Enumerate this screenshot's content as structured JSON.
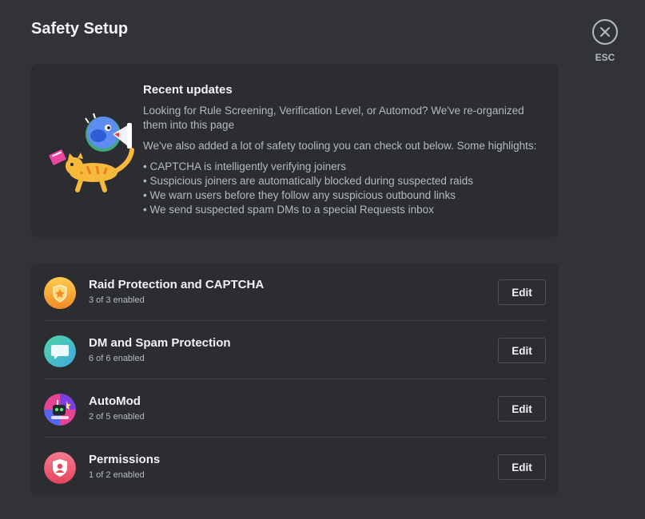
{
  "header": {
    "title": "Safety Setup",
    "close_label": "ESC"
  },
  "updates": {
    "title": "Recent updates",
    "para1": "Looking for Rule Screening, Verification Level, or Automod? We've re-organized them into this page",
    "para2": "We've also added a lot of safety tooling you can check out below. Some highlights:",
    "highlights": [
      "CAPTCHA is intelligently verifying joiners",
      "Suspicious joiners are automatically blocked during suspected raids",
      "We warn users before they follow any suspicious outbound links",
      "We send suspected spam DMs to a special Requests inbox"
    ]
  },
  "settings": {
    "edit_label": "Edit",
    "items": [
      {
        "title": "Raid Protection and CAPTCHA",
        "status": "3 of 3 enabled",
        "icon": "shield-star-icon",
        "color": "#f0a530"
      },
      {
        "title": "DM and Spam Protection",
        "status": "6 of 6 enabled",
        "icon": "chat-bubble-icon",
        "color": "#43c6a8"
      },
      {
        "title": "AutoMod",
        "status": "2 of 5 enabled",
        "icon": "automod-robot-icon",
        "color": "#8f4ee6"
      },
      {
        "title": "Permissions",
        "status": "1 of 2 enabled",
        "icon": "user-shield-icon",
        "color": "#ef5a73"
      }
    ]
  }
}
